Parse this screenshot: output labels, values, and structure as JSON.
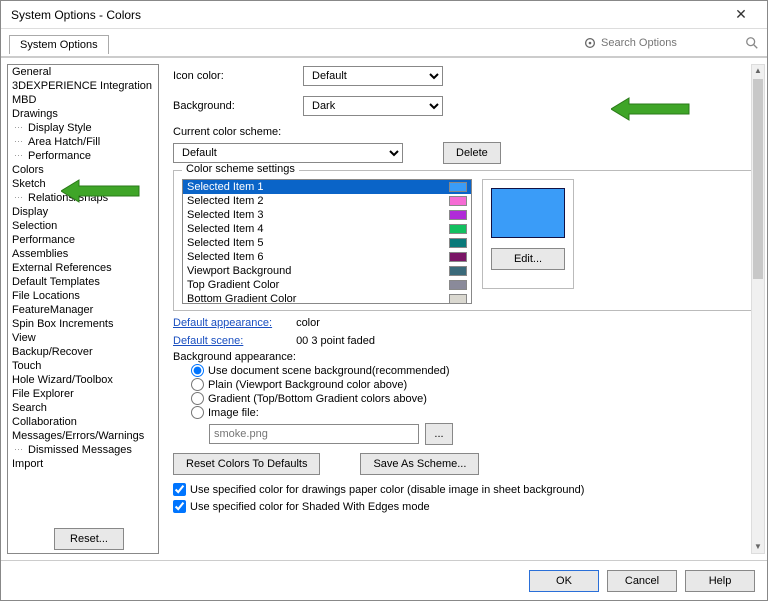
{
  "window": {
    "title": "System Options - Colors"
  },
  "tabs": {
    "system_options": "System Options"
  },
  "search": {
    "placeholder": "Search Options"
  },
  "sidebar": {
    "items": [
      {
        "label": "General"
      },
      {
        "label": "3DEXPERIENCE Integration"
      },
      {
        "label": "MBD"
      },
      {
        "label": "Drawings"
      },
      {
        "label": "Display Style",
        "child": true
      },
      {
        "label": "Area Hatch/Fill",
        "child": true
      },
      {
        "label": "Performance",
        "child": true
      },
      {
        "label": "Colors"
      },
      {
        "label": "Sketch"
      },
      {
        "label": "Relations/Snaps",
        "child": true
      },
      {
        "label": "Display"
      },
      {
        "label": "Selection"
      },
      {
        "label": "Performance"
      },
      {
        "label": "Assemblies"
      },
      {
        "label": "External References"
      },
      {
        "label": "Default Templates"
      },
      {
        "label": "File Locations"
      },
      {
        "label": "FeatureManager"
      },
      {
        "label": "Spin Box Increments"
      },
      {
        "label": "View"
      },
      {
        "label": "Backup/Recover"
      },
      {
        "label": "Touch"
      },
      {
        "label": "Hole Wizard/Toolbox"
      },
      {
        "label": "File Explorer"
      },
      {
        "label": "Search"
      },
      {
        "label": "Collaboration"
      },
      {
        "label": "Messages/Errors/Warnings"
      },
      {
        "label": "Dismissed Messages",
        "child": true
      },
      {
        "label": "Import"
      }
    ],
    "reset": "Reset..."
  },
  "main": {
    "icon_color_label": "Icon color:",
    "icon_color_value": "Default",
    "background_label": "Background:",
    "background_value": "Dark",
    "scheme_label": "Current color scheme:",
    "scheme_value": "Default",
    "delete": "Delete",
    "settings_legend": "Color scheme settings",
    "scheme_items": [
      {
        "label": "Selected Item 1",
        "color": "#3a9cf8",
        "sel": true
      },
      {
        "label": "Selected Item 2",
        "color": "#f56bd4"
      },
      {
        "label": "Selected Item 3",
        "color": "#b02bd8"
      },
      {
        "label": "Selected Item 4",
        "color": "#12c060"
      },
      {
        "label": "Selected Item 5",
        "color": "#0a7a7a"
      },
      {
        "label": "Selected Item 6",
        "color": "#7a1666"
      },
      {
        "label": "Viewport Background",
        "color": "#3a6a7a"
      },
      {
        "label": "Top Gradient Color",
        "color": "#8a8a9a"
      },
      {
        "label": "Bottom Gradient Color",
        "color": "#dad8d0"
      }
    ],
    "edit": "Edit...",
    "default_appearance_label": "Default appearance:",
    "default_appearance_value": "color",
    "default_scene_label": "Default scene:",
    "default_scene_value": "00 3 point faded",
    "bg_appearance_label": "Background appearance:",
    "bg_radios": [
      "Use document scene background(recommended)",
      "Plain (Viewport Background color above)",
      "Gradient (Top/Bottom Gradient colors above)",
      "Image file:"
    ],
    "img_file": "smoke.png",
    "browse": "...",
    "reset_colors": "Reset Colors To Defaults",
    "save_scheme": "Save As Scheme...",
    "chk1": "Use specified color for drawings paper color (disable image in sheet background)",
    "chk2": "Use specified color for Shaded With Edges mode"
  },
  "footer": {
    "ok": "OK",
    "cancel": "Cancel",
    "help": "Help"
  }
}
